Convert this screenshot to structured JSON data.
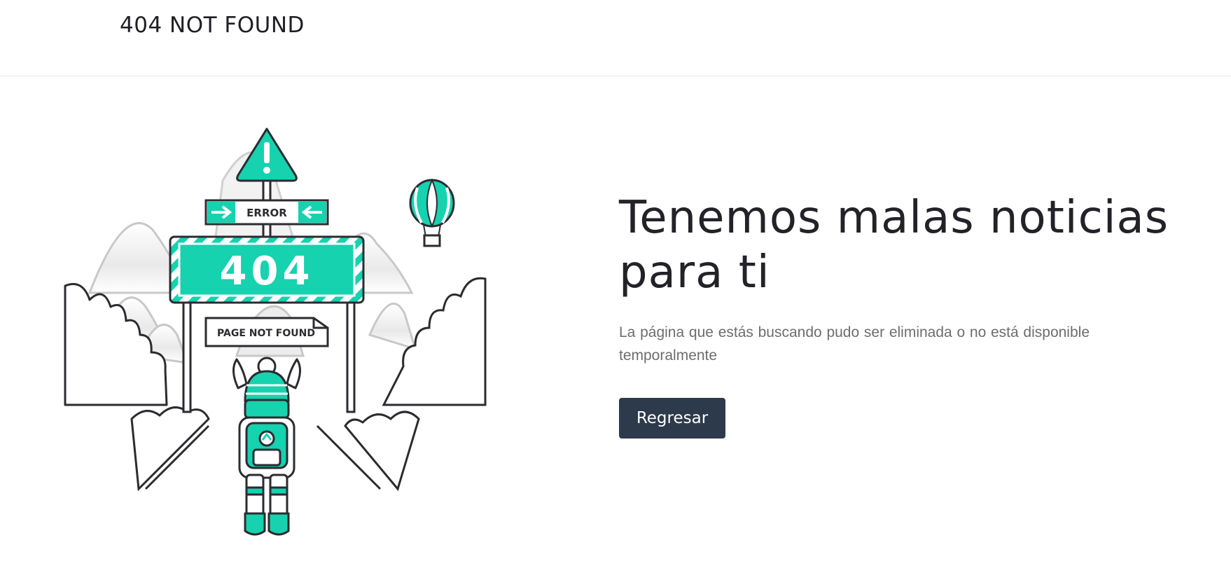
{
  "header": {
    "brand_title": "404 NOT FOUND"
  },
  "illustration": {
    "error_sign": "ERROR",
    "code_sign": "404",
    "page_sign": "PAGE NOT FOUND"
  },
  "main": {
    "headline_line1": "Tenemos malas noticias",
    "headline_line2": "para ti",
    "message": "La página que estás buscando pudo ser eliminada o no está disponible temporalmente",
    "back_button_label": "Regresar"
  },
  "colors": {
    "accent": "#16d2af",
    "button": "#2d3a4b",
    "text_dark": "#222228",
    "text_muted": "#6d6d6d"
  }
}
